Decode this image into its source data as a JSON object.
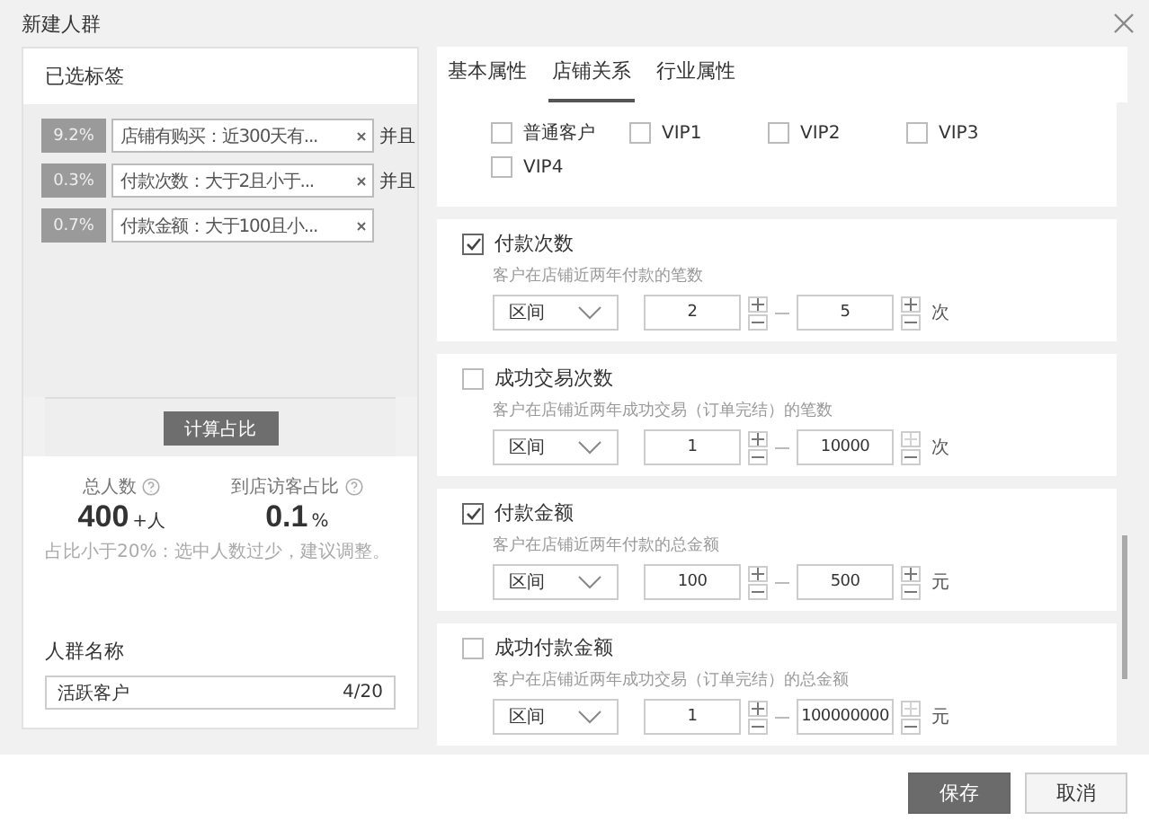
{
  "window": {
    "title": "新建人群"
  },
  "left": {
    "header": "已选标签",
    "tags": [
      {
        "percent": "9.2%",
        "label": "店铺有购买：近300天有...",
        "connector": "并且"
      },
      {
        "percent": "0.3%",
        "label": "付款次数：大于2且小于...",
        "connector": "并且"
      },
      {
        "percent": "0.7%",
        "label": "付款金额：大于100且小..."
      }
    ],
    "calc_button": "计算占比",
    "stats": [
      {
        "label": "总人数",
        "value": "400",
        "unit": "+人"
      },
      {
        "label": "到店访客占比",
        "value": "0.1",
        "unit": "%"
      }
    ],
    "hint": "占比小于20%：选中人数过少，建议调整。",
    "name_field": {
      "label": "人群名称",
      "value": "活跃客户",
      "counter": "4/20"
    }
  },
  "tabs": [
    {
      "label": "基本属性",
      "selected": false
    },
    {
      "label": "店铺关系",
      "selected": true
    },
    {
      "label": "行业属性",
      "selected": false
    }
  ],
  "cards": [
    {
      "kind": "options",
      "options": [
        {
          "label": "普通客户",
          "checked": false
        },
        {
          "label": "VIP1",
          "checked": false
        },
        {
          "label": "VIP2",
          "checked": false
        },
        {
          "label": "VIP3",
          "checked": false
        },
        {
          "label": "VIP4",
          "checked": false
        }
      ]
    },
    {
      "kind": "range",
      "title": "付款次数",
      "checked": true,
      "description": "客户在店铺近两年付款的笔数",
      "mode": "区间",
      "min": "2",
      "max": "5",
      "unit": "次",
      "max_plus_disabled": false
    },
    {
      "kind": "range",
      "title": "成功交易次数",
      "checked": false,
      "description": "客户在店铺近两年成功交易（订单完结）的笔数",
      "mode": "区间",
      "min": "1",
      "max": "10000",
      "unit": "次",
      "max_plus_disabled": true
    },
    {
      "kind": "range",
      "title": "付款金额",
      "checked": true,
      "description": "客户在店铺近两年付款的总金额",
      "mode": "区间",
      "min": "100",
      "max": "500",
      "unit": "元",
      "max_plus_disabled": false
    },
    {
      "kind": "range",
      "title": "成功付款金额",
      "checked": false,
      "description": "客户在店铺近两年成功交易（订单完结）的总金额",
      "mode": "区间",
      "min": "1",
      "max": "100000000",
      "unit": "元",
      "max_plus_disabled": true
    }
  ],
  "footer": {
    "save": "保存",
    "cancel": "取消"
  }
}
